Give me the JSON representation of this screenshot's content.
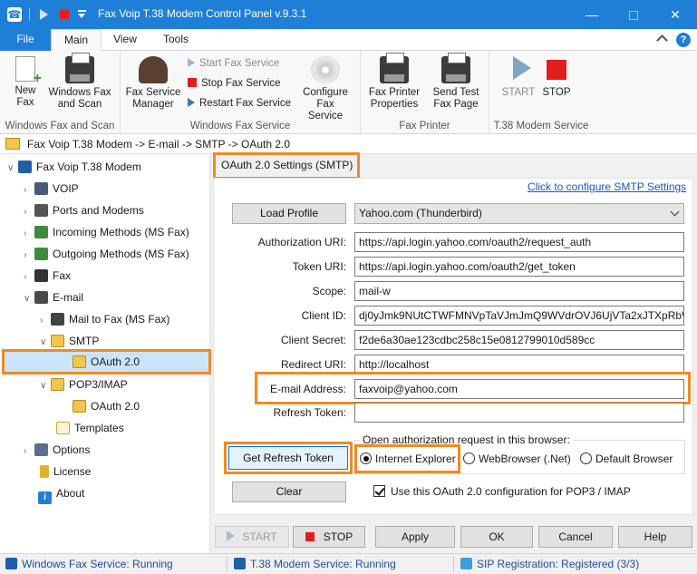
{
  "window": {
    "title": "Fax Voip T.38 Modem Control Panel v.9.3.1",
    "minimize_glyph": "—",
    "close_glyph": "✕"
  },
  "ribbon_tabs": {
    "file": "File",
    "main": "Main",
    "view": "View",
    "tools": "Tools",
    "help_glyph": "?"
  },
  "ribbon": {
    "windows_fax_scan": {
      "group_label": "Windows Fax and Scan",
      "new_fax": "New Fax",
      "windows_fax_and_scan": "Windows Fax and Scan"
    },
    "windows_fax_service": {
      "group_label": "Windows Fax Service",
      "fax_service_manager": "Fax Service Manager",
      "start_fax_service": "Start Fax Service",
      "stop_fax_service": "Stop Fax Service",
      "restart_fax_service": "Restart Fax Service",
      "configure_fax_service": "Configure Fax Service"
    },
    "fax_printer": {
      "group_label": "Fax Printer",
      "fax_printer_properties": "Fax Printer Properties",
      "send_test_fax_page": "Send Test Fax Page"
    },
    "t38_service": {
      "group_label": "T.38 Modem Service",
      "start": "START",
      "stop": "STOP"
    }
  },
  "breadcrumb": "Fax Voip T.38 Modem -> E-mail -> SMTP -> OAuth 2.0",
  "tree": {
    "root": "Fax Voip T.38 Modem",
    "voip": "VOIP",
    "ports": "Ports and Modems",
    "incoming": "Incoming Methods (MS Fax)",
    "outgoing": "Outgoing Methods (MS Fax)",
    "fax": "Fax",
    "email": "E-mail",
    "mail_to_fax": "Mail to Fax (MS Fax)",
    "smtp": "SMTP",
    "smtp_oauth": "OAuth 2.0",
    "pop3": "POP3/IMAP",
    "pop3_oauth": "OAuth 2.0",
    "templates": "Templates",
    "options": "Options",
    "license": "License",
    "about": "About",
    "about_glyph": "i"
  },
  "section": {
    "title": "OAuth 2.0 Settings (SMTP)",
    "configure_link": "Click to configure SMTP Settings",
    "load_profile": "Load Profile",
    "profile_value": "Yahoo.com (Thunderbird)"
  },
  "fields": {
    "auth_uri_label": "Authorization URI:",
    "auth_uri_value": "https://api.login.yahoo.com/oauth2/request_auth",
    "token_uri_label": "Token URI:",
    "token_uri_value": "https://api.login.yahoo.com/oauth2/get_token",
    "scope_label": "Scope:",
    "scope_value": "mail-w",
    "client_id_label": "Client ID:",
    "client_id_value": "dj0yJmk9NUtCTWFMNVpTaVJmJmQ9WVdrOVJ6UjVTa2xJTXpRbWNH",
    "client_secret_label": "Client Secret:",
    "client_secret_value": "f2de6a30ae123cdbc258c15e0812799010d589cc",
    "redirect_uri_label": "Redirect URI:",
    "redirect_uri_value": "http://localhost",
    "email_label": "E-mail Address:",
    "email_value": "faxvoip@yahoo.com",
    "refresh_token_label": "Refresh Token:",
    "refresh_token_value": ""
  },
  "browser": {
    "group_title": "Open authorization request in this browser:",
    "get_refresh_token": "Get Refresh Token",
    "ie": "Internet Explorer",
    "webbrowser": "WebBrowser (.Net)",
    "default": "Default Browser",
    "selected": "Internet Explorer"
  },
  "clear": "Clear",
  "use_for_pop3": "Use this OAuth 2.0 configuration for POP3 / IMAP",
  "footer_buttons": {
    "start": "START",
    "stop": "STOP",
    "apply": "Apply",
    "ok": "OK",
    "cancel": "Cancel",
    "help": "Help"
  },
  "status": {
    "fax_service": "Windows Fax Service: Running",
    "t38_service": "T.38 Modem Service: Running",
    "sip": "SIP Registration: Registered (3/3)"
  },
  "colors": {
    "title_bar": "#1e7fd8",
    "highlight": "#f08a24",
    "link": "#1656c7",
    "stop_red": "#e51c1c"
  }
}
